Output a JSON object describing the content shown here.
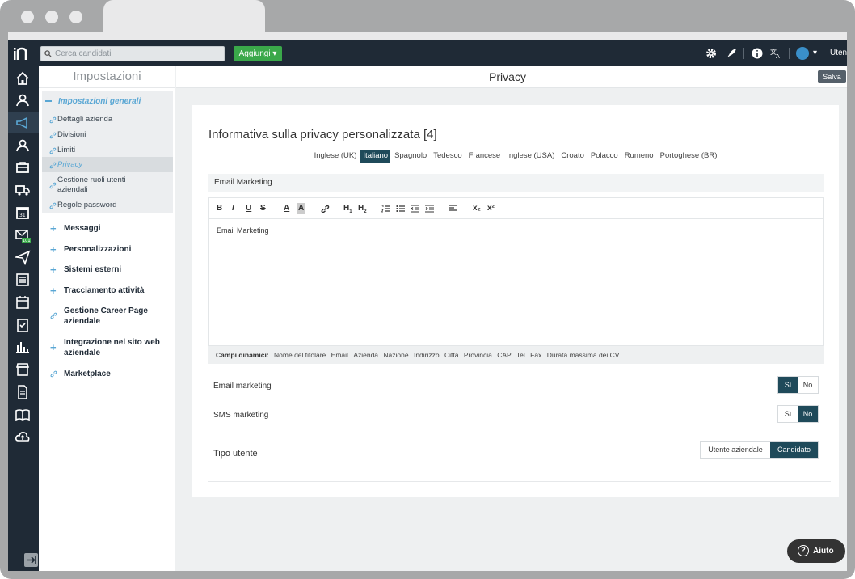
{
  "header": {
    "search_placeholder": "Cerca candidati",
    "add_label": "Aggiungi",
    "user_label": "Utente"
  },
  "settings": {
    "title": "Impostazioni",
    "group_label": "Impostazioni generali",
    "sub_items": [
      {
        "label": "Dettagli azienda"
      },
      {
        "label": "Divisioni"
      },
      {
        "label": "Limiti"
      },
      {
        "label": "Privacy"
      },
      {
        "label": "Gestione ruoli utenti aziendali"
      },
      {
        "label": "Regole password"
      }
    ],
    "sections": [
      {
        "label": "Messaggi"
      },
      {
        "label": "Personalizzazioni"
      },
      {
        "label": "Sistemi esterni"
      },
      {
        "label": "Tracciamento attività"
      },
      {
        "label": "Gestione Career Page aziendale"
      },
      {
        "label": "Integrazione nel sito web aziendale"
      },
      {
        "label": "Marketplace"
      }
    ]
  },
  "main": {
    "page_title": "Privacy",
    "save_label": "Salva",
    "card_title": "Informativa sulla privacy personalizzata [4]",
    "languages": [
      "Inglese (UK)",
      "Italiano",
      "Spagnolo",
      "Tedesco",
      "Francese",
      "Inglese (USA)",
      "Croato",
      "Polacco",
      "Rumeno",
      "Portoghese (BR)"
    ],
    "active_language": "Italiano",
    "subject_value": "Email Marketing",
    "editor_text": "Email Marketing",
    "toolbar": [
      "B",
      "I",
      "U",
      "S",
      "A",
      "A",
      "link",
      "H1",
      "H2",
      "ol",
      "ul",
      "outdent",
      "indent",
      "align",
      "x₂",
      "x²"
    ],
    "dynamic_label": "Campi dinamici:",
    "dynamic_fields": [
      "Nome del titolare",
      "Email",
      "Azienda",
      "Nazione",
      "Indirizzo",
      "Città",
      "Provincia",
      "CAP",
      "Tel",
      "Fax",
      "Durata massima dei CV"
    ],
    "email_marketing": {
      "label": "Email marketing",
      "yes": "Sì",
      "no": "No",
      "selected": "Sì"
    },
    "sms_marketing": {
      "label": "SMS marketing",
      "yes": "Sì",
      "no": "No",
      "selected": "No"
    },
    "user_type": {
      "label": "Tipo utente",
      "option_a": "Utente aziendale",
      "option_b": "Candidato",
      "selected": "Candidato"
    }
  },
  "help_label": "Aiuto",
  "badge_count": "101",
  "colors": {
    "nav": "#1f2a36",
    "accent": "#5aa7d4",
    "add_button": "#3aa84a",
    "active_toggle": "#1f4a5a"
  }
}
